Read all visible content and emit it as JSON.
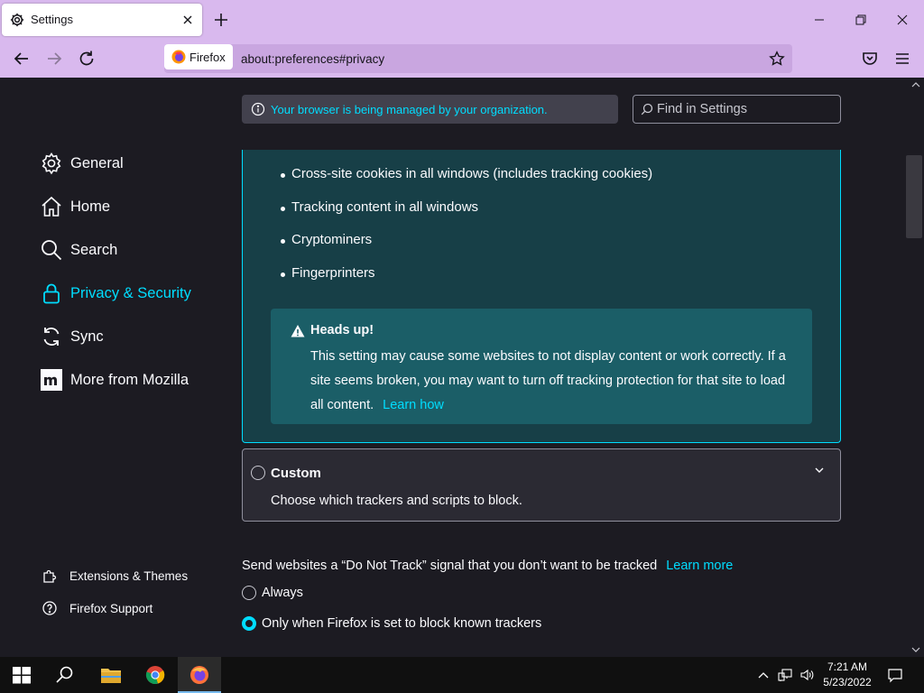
{
  "browser": {
    "tab": {
      "title": "Settings",
      "icon": "gear-icon"
    },
    "identity_label": "Firefox",
    "url": "about:preferences#privacy"
  },
  "page": {
    "managed_notice": "Your browser is being managed by your organization.",
    "search_placeholder": "Find in Settings"
  },
  "sidebar": {
    "items": [
      {
        "label": "General",
        "icon": "gear-icon"
      },
      {
        "label": "Home",
        "icon": "home-icon"
      },
      {
        "label": "Search",
        "icon": "search-icon"
      },
      {
        "label": "Privacy & Security",
        "icon": "lock-icon",
        "active": true
      },
      {
        "label": "Sync",
        "icon": "sync-icon"
      },
      {
        "label": "More from Mozilla",
        "icon": "mozilla-icon"
      }
    ],
    "footer": [
      {
        "label": "Extensions & Themes",
        "icon": "puzzle-icon"
      },
      {
        "label": "Firefox Support",
        "icon": "help-icon"
      }
    ]
  },
  "strict": {
    "bullets": [
      "Cross-site cookies in all windows (includes tracking cookies)",
      "Tracking content in all windows",
      "Cryptominers",
      "Fingerprinters"
    ],
    "warning": {
      "title": "Heads up!",
      "body": "This setting may cause some websites to not display content or work correctly. If a site seems broken, you may want to turn off tracking protection for that site to load all content.",
      "link": "Learn how"
    }
  },
  "custom": {
    "title": "Custom",
    "description": "Choose which trackers and scripts to block."
  },
  "dnt": {
    "text": "Send websites a “Do Not Track” signal that you don’t want to be tracked",
    "link": "Learn more",
    "options": [
      {
        "label": "Always",
        "selected": false
      },
      {
        "label": "Only when Firefox is set to block known trackers",
        "selected": true
      }
    ]
  },
  "taskbar": {
    "time": "7:21 AM",
    "date": "5/23/2022"
  },
  "colors": {
    "accent": "#00ddff",
    "toolbar": "#d9b9ee",
    "background": "#1c1b22"
  }
}
